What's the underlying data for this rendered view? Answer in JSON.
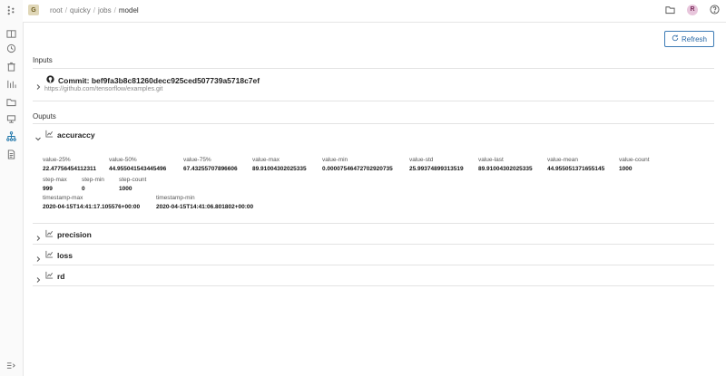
{
  "header": {
    "org_initial": "G",
    "avatar_initial": "R",
    "breadcrumb": [
      "root",
      "quicky",
      "jobs",
      "model"
    ]
  },
  "toolbar": {
    "refresh_label": "Refresh"
  },
  "inputs": {
    "title": "Inputs",
    "commit_label": "Commit: bef9fa3b8c81260decc925ced507739a5718c7ef",
    "repo_url": "https://github.com/tensorflow/examples.git"
  },
  "outputs": {
    "title": "Ouputs",
    "items": [
      {
        "name": "accuraccy",
        "expanded": true
      },
      {
        "name": "precision",
        "expanded": false
      },
      {
        "name": "loss",
        "expanded": false
      },
      {
        "name": "rd",
        "expanded": false
      }
    ],
    "metrics": [
      {
        "key": "value-25%",
        "value": "22.47756454112311"
      },
      {
        "key": "value-50%",
        "value": "44.955041543445496"
      },
      {
        "key": "value-75%",
        "value": "67.43255707896606"
      },
      {
        "key": "value-max",
        "value": "89.91004302025335"
      },
      {
        "key": "value-min",
        "value": "0.00007546472702920735"
      },
      {
        "key": "value-std",
        "value": "25.99374899313519"
      },
      {
        "key": "value-last",
        "value": "89.91004302025335"
      },
      {
        "key": "value-mean",
        "value": "44.955051371655145"
      },
      {
        "key": "value-count",
        "value": "1000"
      },
      {
        "key": "step-max",
        "value": "999"
      },
      {
        "key": "step-min",
        "value": "0"
      },
      {
        "key": "step-count",
        "value": "1000"
      },
      {
        "key": "timestamp-max",
        "value": "2020-04-15T14:41:17.105576+00:00"
      },
      {
        "key": "timestamp-min",
        "value": "2020-04-15T14:41:06.801802+00:00"
      }
    ]
  },
  "icons": {
    "sidebar": [
      "logo-icon",
      "book-icon",
      "history-icon",
      "archive-icon",
      "chart-icon",
      "folder-icon",
      "model-icon",
      "lineage-icon",
      "document-icon",
      "collapse-icon"
    ],
    "top_right": [
      "folder-icon",
      "help-icon"
    ]
  }
}
